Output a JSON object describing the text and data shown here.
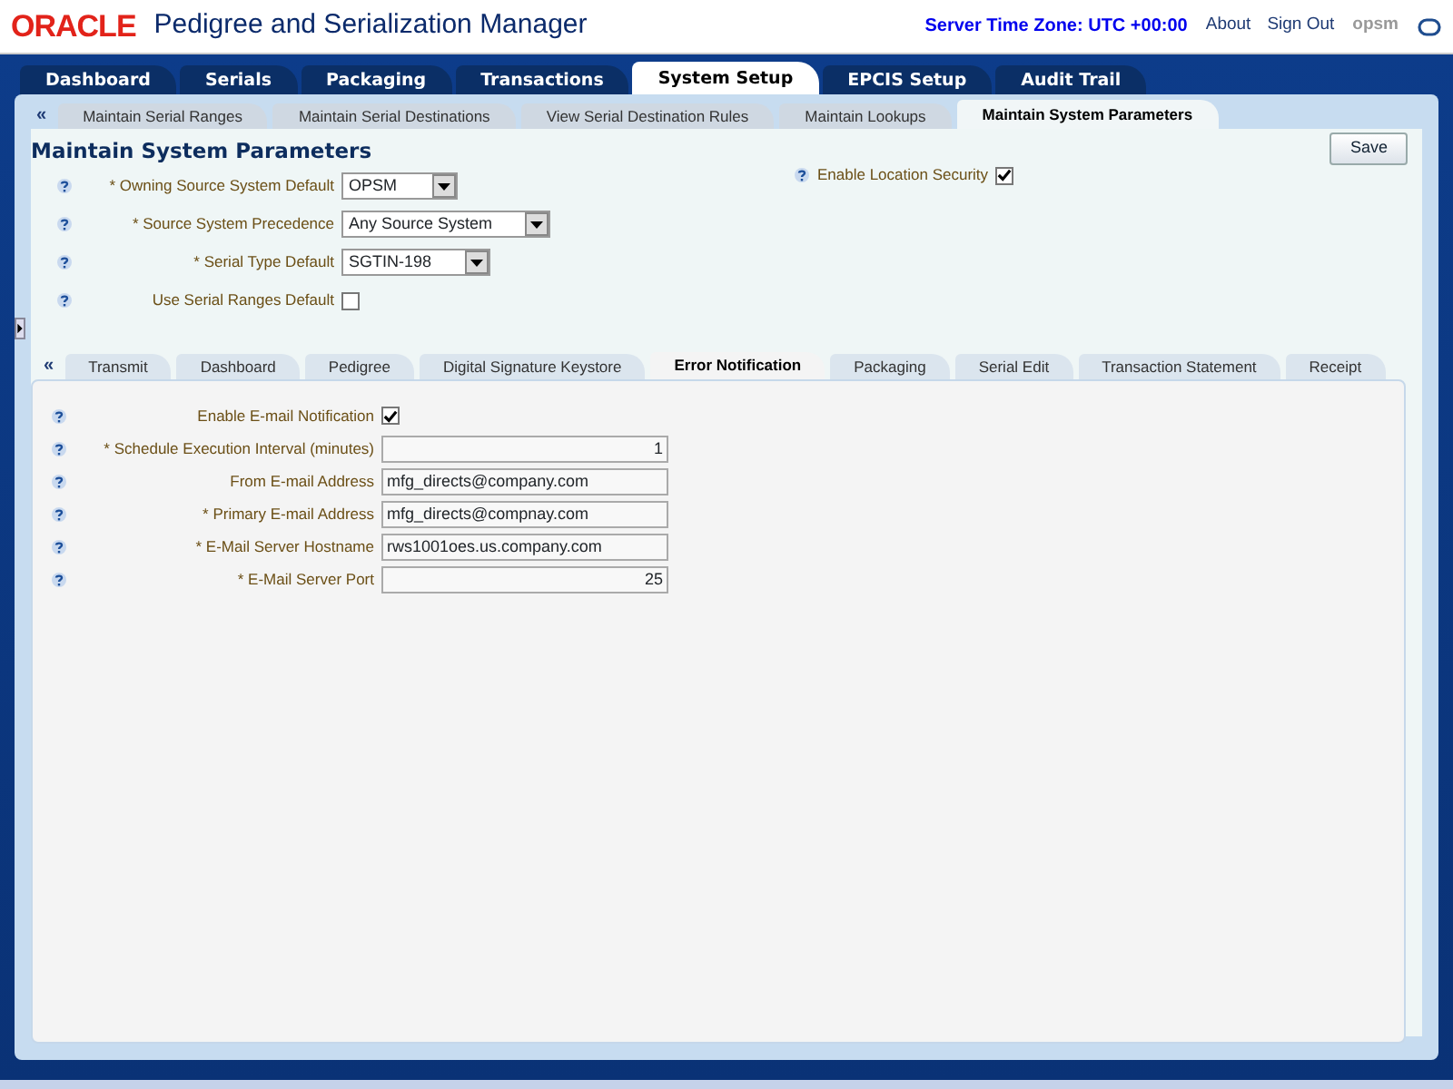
{
  "header": {
    "logo": "ORACLE",
    "app_title": "Pedigree and Serialization Manager",
    "server_time": "Server Time Zone: UTC +00:00",
    "links": [
      "About",
      "Sign Out"
    ],
    "user": "opsm"
  },
  "main_tabs": [
    {
      "label": "Dashboard",
      "selected": false
    },
    {
      "label": "Serials",
      "selected": false
    },
    {
      "label": "Packaging",
      "selected": false
    },
    {
      "label": "Transactions",
      "selected": false
    },
    {
      "label": "System Setup",
      "selected": true
    },
    {
      "label": "EPCIS Setup",
      "selected": false
    },
    {
      "label": "Audit Trail",
      "selected": false
    }
  ],
  "sub_tabs_scroll": "«",
  "sub_tabs": [
    {
      "label": "Maintain Serial Ranges",
      "selected": false
    },
    {
      "label": "Maintain Serial Destinations",
      "selected": false
    },
    {
      "label": "View Serial Destination Rules",
      "selected": false
    },
    {
      "label": "Maintain Lookups",
      "selected": false
    },
    {
      "label": "Maintain System Parameters",
      "selected": true
    }
  ],
  "page_title": "Maintain System Parameters",
  "save_button": "Save",
  "parameters": [
    {
      "kind": "select",
      "label": "* Owning Source System Default",
      "value": "OPSM"
    },
    {
      "kind": "select",
      "label": "* Source System Precedence",
      "value": "Any Source System"
    },
    {
      "kind": "select",
      "label": "* Serial Type Default",
      "value": "SGTIN-198"
    },
    {
      "kind": "checkbox",
      "label": "Use Serial Ranges Default",
      "checked": false
    }
  ],
  "location_security": {
    "label": "Enable Location Security",
    "checked": true
  },
  "detail_tabs_scroll": "«",
  "detail_tabs": [
    {
      "label": "Transmit",
      "selected": false
    },
    {
      "label": "Dashboard",
      "selected": false
    },
    {
      "label": "Pedigree",
      "selected": false
    },
    {
      "label": "Digital Signature Keystore",
      "selected": false
    },
    {
      "label": "Error Notification",
      "selected": true
    },
    {
      "label": "Packaging",
      "selected": false
    },
    {
      "label": "Serial Edit",
      "selected": false
    },
    {
      "label": "Transaction Statement",
      "selected": false
    },
    {
      "label": "Receipt",
      "selected": false
    }
  ],
  "notification_fields": [
    {
      "kind": "checkbox",
      "label": "Enable E-mail Notification",
      "checked": true
    },
    {
      "kind": "number",
      "label": "* Schedule Execution Interval (minutes)",
      "value": "1"
    },
    {
      "kind": "text",
      "label": "From E-mail Address",
      "value": "mfg_directs@company.com"
    },
    {
      "kind": "text",
      "label": "* Primary E-mail Address",
      "value": "mfg_directs@compnay.com"
    },
    {
      "kind": "text",
      "label": "* E-Mail Server Hostname",
      "value": "rws1001oes.us.company.com"
    },
    {
      "kind": "number",
      "label": "* E-Mail Server Port",
      "value": "25"
    }
  ]
}
